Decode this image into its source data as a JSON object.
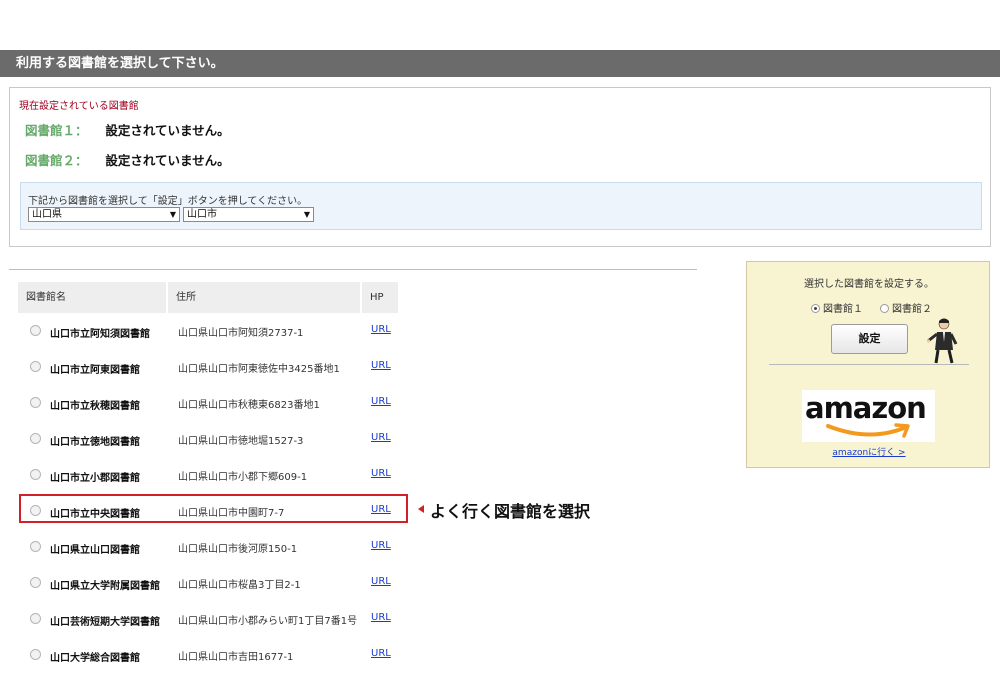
{
  "header": {
    "title": "利用する図書館を選択して下さい。"
  },
  "current": {
    "title": "現在設定されている図書館",
    "lib1_label": "図書館１：",
    "lib1_value": "設定されていません。",
    "lib2_label": "図書館２：",
    "lib2_value": "設定されていません。",
    "instruction": "下記から図書館を選択して「設定」ボタンを押してください。",
    "prefecture": "山口県",
    "city": "山口市"
  },
  "table": {
    "headers": {
      "name": "図書館名",
      "address": "住所",
      "hp": "HP"
    },
    "rows": [
      {
        "name": "山口市立阿知須図書館",
        "address": "山口県山口市阿知須2737-1",
        "url": "URL"
      },
      {
        "name": "山口市立阿東図書館",
        "address": "山口県山口市阿東徳佐中3425番地1",
        "url": "URL"
      },
      {
        "name": "山口市立秋穂図書館",
        "address": "山口県山口市秋穂東6823番地1",
        "url": "URL"
      },
      {
        "name": "山口市立徳地図書館",
        "address": "山口県山口市徳地堀1527-3",
        "url": "URL"
      },
      {
        "name": "山口市立小郡図書館",
        "address": "山口県山口市小郡下郷609-1",
        "url": "URL"
      },
      {
        "name": "山口市立中央図書館",
        "address": "山口県山口市中園町7-7",
        "url": "URL"
      },
      {
        "name": "山口県立山口図書館",
        "address": "山口県山口市後河原150-1",
        "url": "URL"
      },
      {
        "name": "山口県立大学附属図書館",
        "address": "山口県山口市桜畠3丁目2-1",
        "url": "URL"
      },
      {
        "name": "山口芸術短期大学図書館",
        "address": "山口県山口市小郡みらい町1丁目7番1号",
        "url": "URL"
      },
      {
        "name": "山口大学総合図書館",
        "address": "山口県山口市吉田1677-1",
        "url": "URL"
      }
    ]
  },
  "annotation": {
    "text": "よく行く図書館を選択"
  },
  "side": {
    "title": "選択した図書館を設定する。",
    "radio1": "図書館１",
    "radio2": "図書館２",
    "set_button": "設定",
    "amazon_logo": "amazon",
    "amazon_link": "amazonに行く >"
  },
  "colors": {
    "header_bg": "#6b6b6b",
    "accent_red": "#d0202a",
    "label_green": "#66aa6a",
    "title_red": "#a0001e",
    "panel_blue": "#edf4fb",
    "panel_yellow": "#f8f4d2",
    "link_blue": "#1a3ccc"
  }
}
